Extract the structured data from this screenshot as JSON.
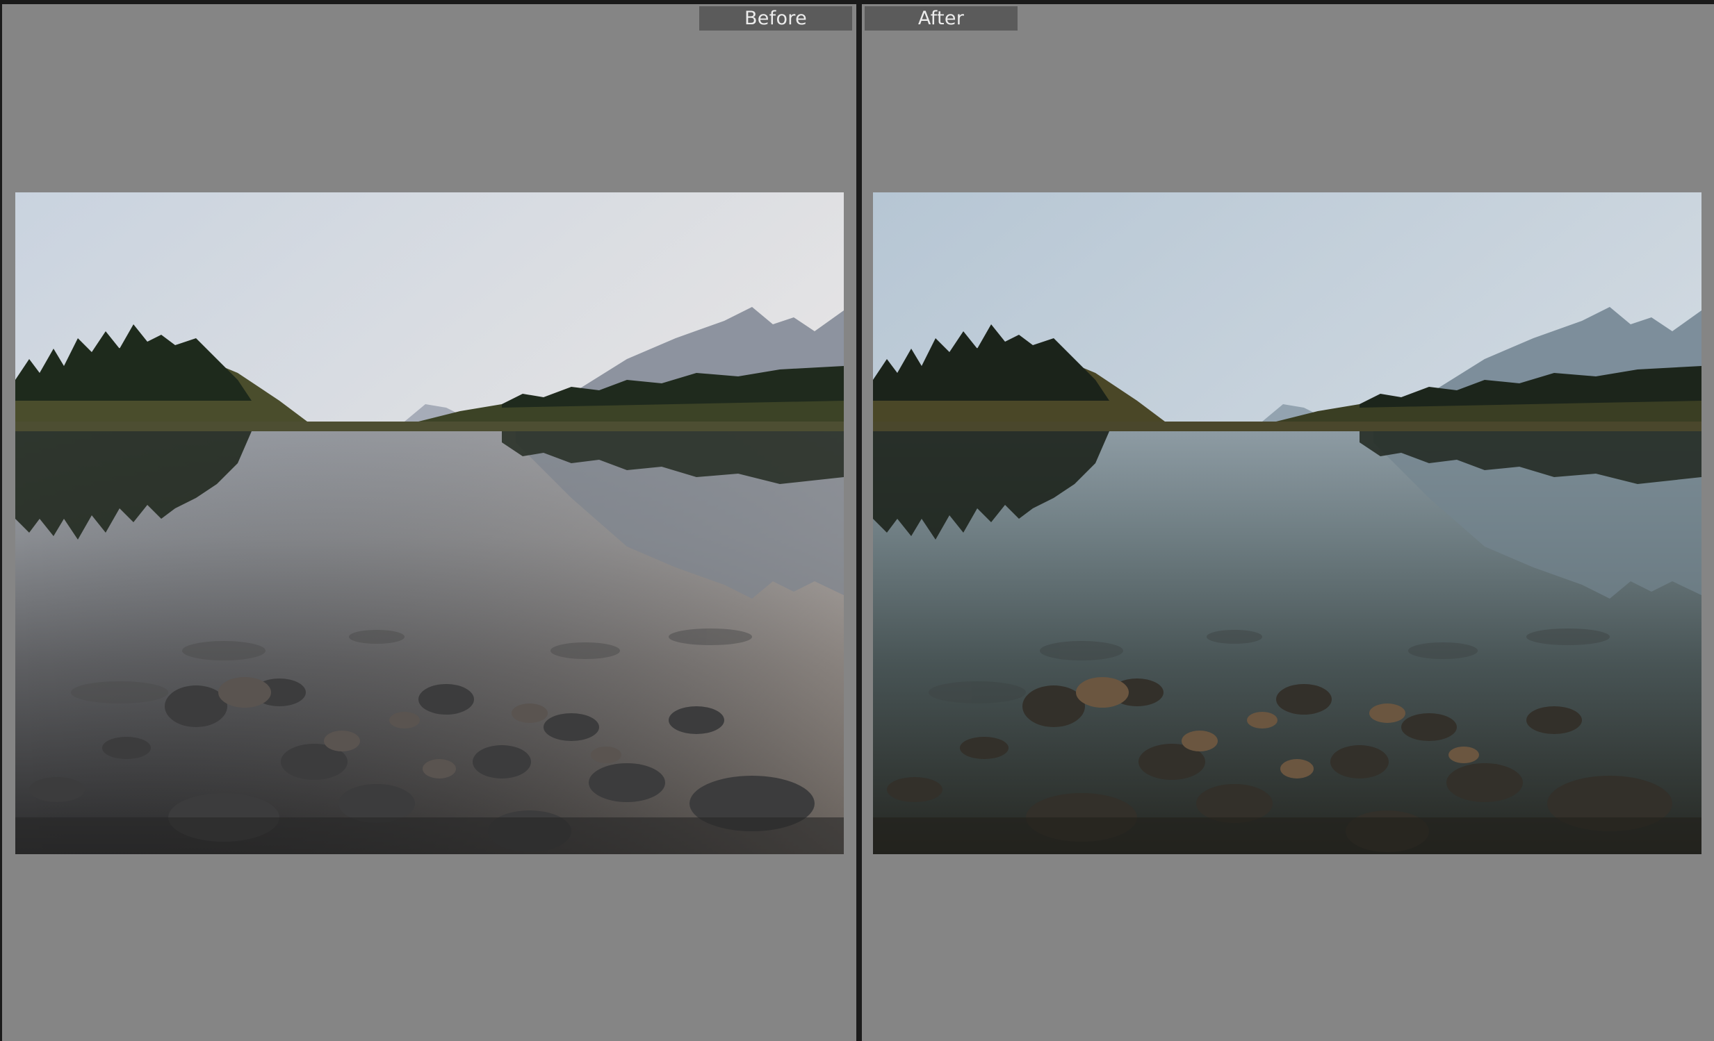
{
  "compare_view": {
    "before": {
      "label": "Before",
      "photo_icon": "landscape-photo-icon"
    },
    "after": {
      "label": "After",
      "photo_icon": "landscape-photo-icon"
    }
  },
  "colors": {
    "pane_background": "#858585",
    "divider": "#1b1b1b",
    "label_background": "#5b5b5b",
    "label_text": "#ececec"
  }
}
